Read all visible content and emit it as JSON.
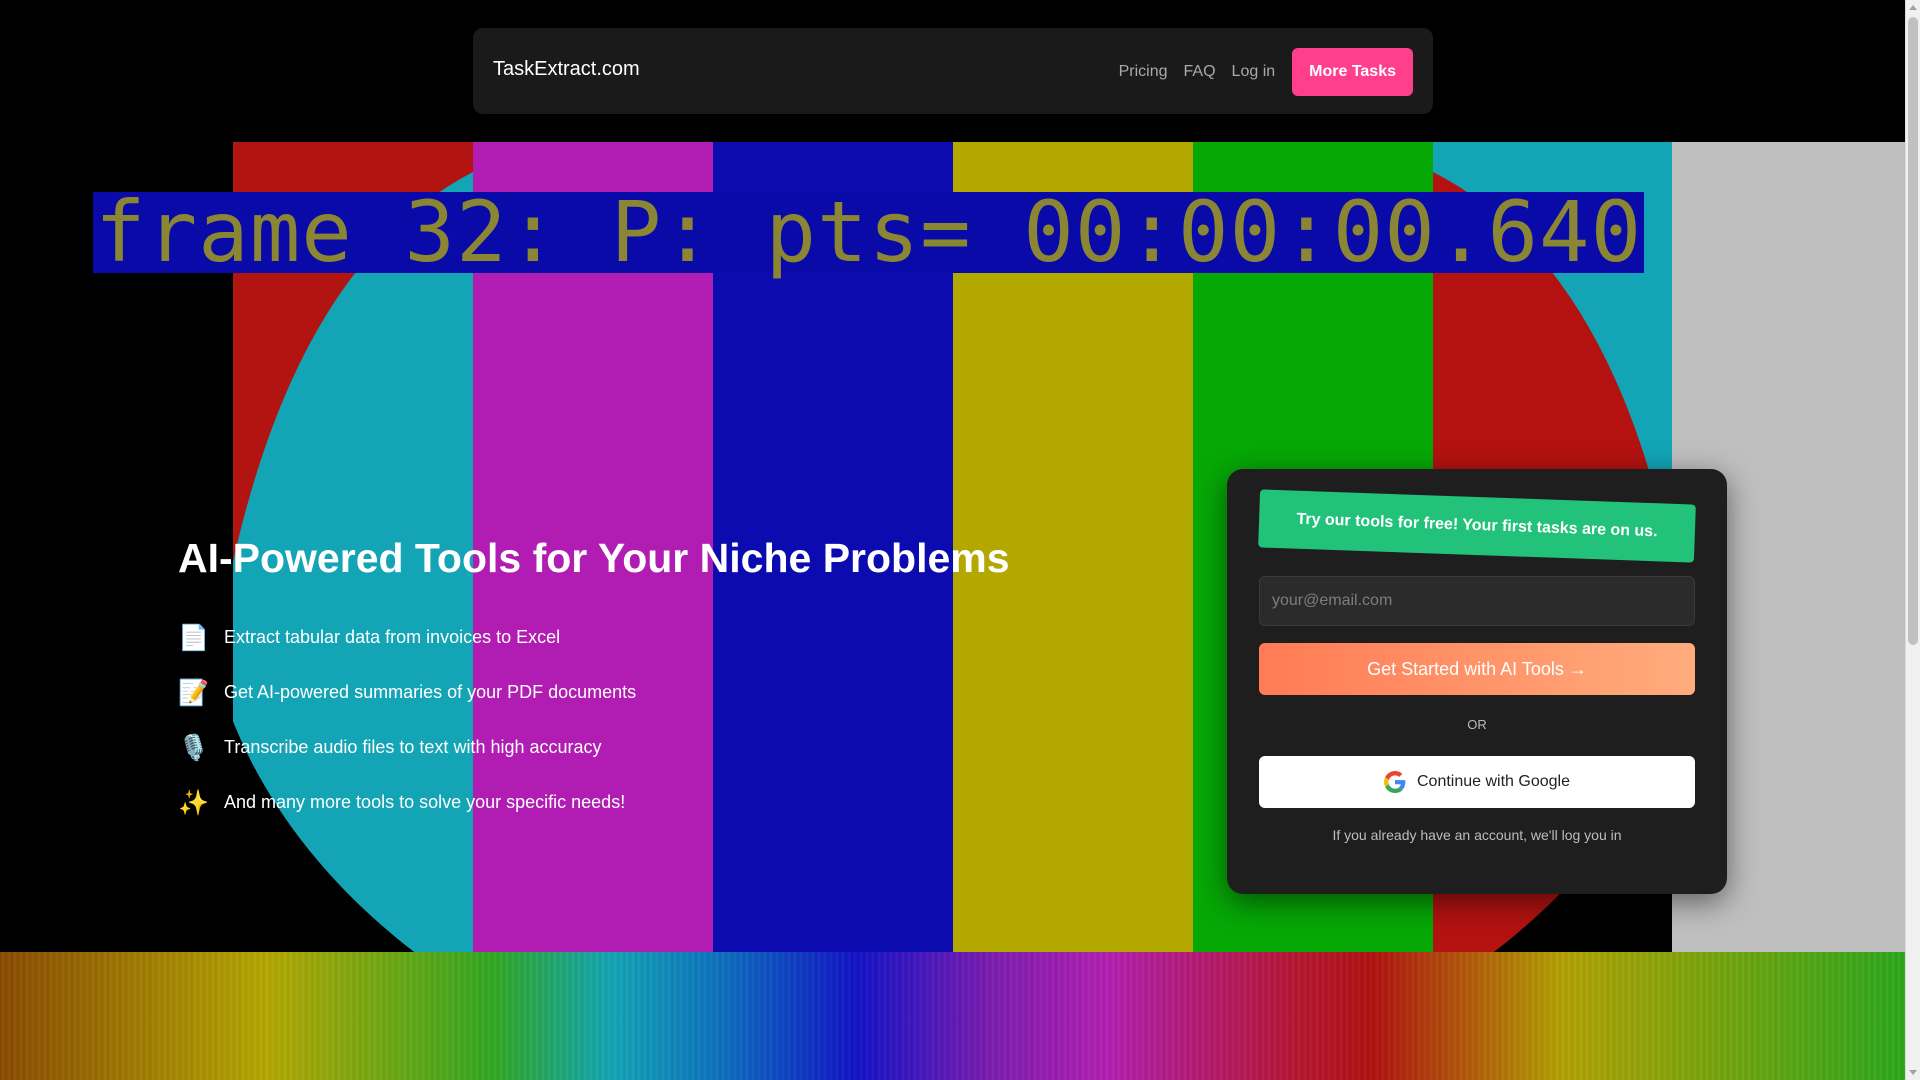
{
  "colors": {
    "bars": [
      "#b11411",
      "#b11db2",
      "#0b0bb0",
      "#b3a800",
      "#06a806",
      "#b31210",
      "#bfbfbf"
    ],
    "disc_left": "#13a5b6",
    "disc_right": "#b31210",
    "accent_pink": "#ff3f8c",
    "promo_green": "#22c27a",
    "cta_start": "#ff7b55",
    "cta_end": "#ffac7c"
  },
  "overlay": {
    "frame_text": "frame 32: P: pts= 00:00:00.640"
  },
  "header": {
    "brand": "TaskExtract.com",
    "nav": [
      "Pricing",
      "FAQ",
      "Log in"
    ],
    "more_tasks": "More Tasks"
  },
  "hero": {
    "title": "AI-Powered Tools for Your Niche Problems",
    "features": [
      {
        "icon": "page-facing-up-icon",
        "emoji": "📄",
        "text": "Extract tabular data from invoices to Excel"
      },
      {
        "icon": "memo-icon",
        "emoji": "📝",
        "text": "Get AI-powered summaries of your PDF documents"
      },
      {
        "icon": "microphone-icon",
        "emoji": "🎙️",
        "text": "Transcribe audio files to text with high accuracy"
      },
      {
        "icon": "sparkles-icon",
        "emoji": "✨",
        "text": "And many more tools to solve your specific needs!"
      }
    ]
  },
  "signup": {
    "promo": "Try our tools for free! Your first tasks are on us.",
    "email_placeholder": "your@email.com",
    "cta": "Get Started with AI Tools →",
    "or": "OR",
    "google": "Continue with Google",
    "note": "If you already have an account, we'll log you in"
  }
}
